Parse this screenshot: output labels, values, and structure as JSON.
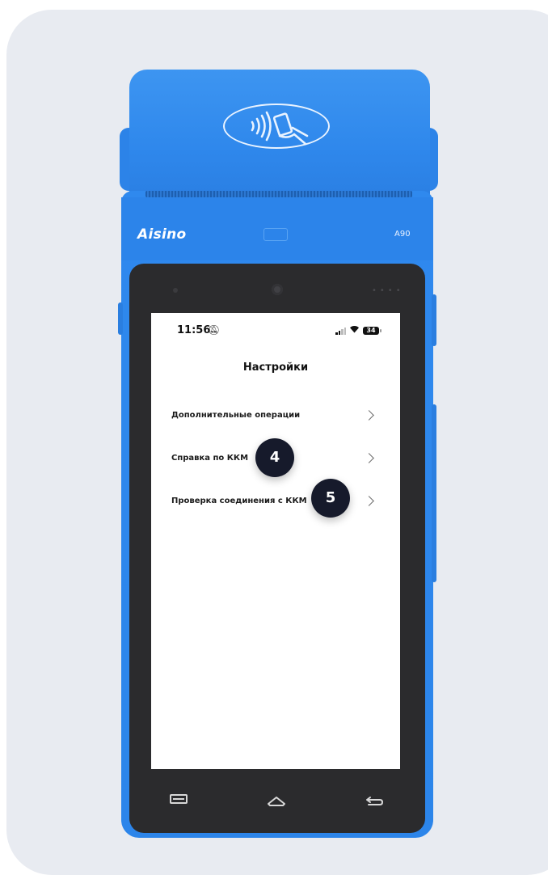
{
  "device": {
    "brand": "Aisino",
    "model": "A90"
  },
  "status_bar": {
    "time": "11:56",
    "battery": "34"
  },
  "screen": {
    "title": "Настройки",
    "menu_items": [
      {
        "label": "Дополнительные операции"
      },
      {
        "label": "Справка по ККМ"
      },
      {
        "label": "Проверка соединения с ККМ"
      }
    ]
  },
  "step_badges": [
    "4",
    "5"
  ],
  "colors": {
    "device_blue": "#2f88ec",
    "badge": "#161a2b",
    "background": "#e8ebf1"
  }
}
